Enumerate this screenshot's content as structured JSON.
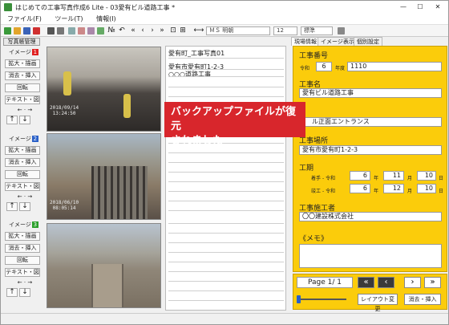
{
  "window": {
    "title": "はじめての工事写真作成6 Lite - 03愛有ビル道路工事 *",
    "min": "—",
    "max": "☐",
    "close": "✕"
  },
  "menu": [
    "ファイル(F)",
    "ツール(T)",
    "情報(I)"
  ],
  "toolbar": {
    "font": "ＭＳ 明朝",
    "size": "12",
    "style": "標準",
    "no_label": "№"
  },
  "left": {
    "header": "写真帳管理",
    "images": [
      {
        "label": "イメージ",
        "num": "1",
        "color": "#e02020"
      },
      {
        "label": "イメージ",
        "num": "2",
        "color": "#2a60c8"
      },
      {
        "label": "イメージ",
        "num": "3",
        "color": "#2aa02a"
      }
    ],
    "buttons": {
      "enlarge": "拡大・描画",
      "delete": "消去・挿入",
      "rotate": "回転",
      "text": "テキスト・図"
    }
  },
  "photos": {
    "stamp1": "2018/09/14\n 13:24:50",
    "stamp2": "2018/06/10\n 08:05:14"
  },
  "text_lines": [
    "愛有町_工事写真01",
    "愛有市愛有町1-2-3",
    "○○○道路工事"
  ],
  "notice": {
    "line1": "バックアップファイルが復元",
    "line2": "されました"
  },
  "tabs": [
    "現場情報",
    "イメージ表示",
    "個別設定"
  ],
  "panel": {
    "kouji_bango_label": "工事番号",
    "reiwa": "令和",
    "year": "6",
    "nendo": "年度",
    "number": "1110",
    "kouji_mei_label": "工事名",
    "kouji_mei": "愛有ビル道路工事",
    "kouji_mei2": "ル正面エントランス",
    "kouji_basho_label": "工事場所",
    "kouji_basho": "愛有市愛有町1-2-3",
    "kouki_label": "工期",
    "chakushu": "着手",
    "shunko": "竣工",
    "reiwa_prefix": "- 令和",
    "start": {
      "y": "6",
      "m": "11",
      "d": "10"
    },
    "end": {
      "y": "6",
      "m": "12",
      "d": "10"
    },
    "nen": "年",
    "tsuki": "月",
    "hi": "日",
    "sekou_label": "工事施工者",
    "sekou": "〇〇建設株式会社",
    "memo_label": "《メモ》"
  },
  "nav": {
    "page": "Page 1/ 1",
    "layout_btn": "レイアウト変更",
    "delete_btn": "消去・挿入"
  }
}
